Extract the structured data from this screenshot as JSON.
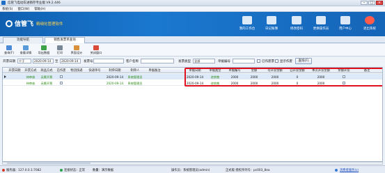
{
  "window": {
    "title": "信管飞电动车进销存专业版 V9.2.446"
  },
  "menu": [
    "系统(S)",
    "窗口(W)",
    "帮助(H)"
  ],
  "brand": {
    "name": "信管飞",
    "subtitle": "精细化管理软件"
  },
  "top_buttons": [
    {
      "label": "我的工作台",
      "icon": "desktop-icon"
    },
    {
      "label": "日记账簿",
      "icon": "ledger-icon"
    },
    {
      "label": "修改密码",
      "icon": "key-icon"
    },
    {
      "label": "更换操作员",
      "icon": "user-switch-icon"
    },
    {
      "label": "用户中心",
      "icon": "user-center-icon"
    },
    {
      "label": "退出系统",
      "icon": "power-icon"
    }
  ],
  "tabs": [
    "功能导航",
    "销售发票单查询"
  ],
  "toolbar": [
    "查询(F)",
    "查看详情",
    "导出数据",
    "打印",
    "界面设计",
    "关闭窗口"
  ],
  "filter": {
    "date_label": "开票日期",
    "date_op": "介于",
    "date_from": "2020-09-14",
    "date_sep": "至",
    "date_to": "2020-09-14",
    "invoice_no_label": "发票号",
    "invoice_no": "",
    "customer_label": "客户名称",
    "customer": "",
    "type_label": "发票类型",
    "type": "全部",
    "doc_no_label": "单据编号",
    "doc_no": "",
    "cb_voided": "已作废票",
    "cb_show_detail": "显示作废",
    "query_btn": "查询(F)"
  },
  "grid": {
    "columns": [
      "开票日期",
      "开票方式",
      "商品方式",
      "已作废",
      "物流快递",
      "快递单号",
      "制单日期",
      "制单人",
      "单据备注",
      "单据日期",
      "单据类型",
      "单据编号",
      "金额",
      "可开票金额",
      "已开票金额",
      "本次开票金额",
      "余额开票",
      "备注"
    ],
    "rows": [
      [
        "",
        "待审核",
        "无需开票",
        "",
        "",
        "",
        "2020-09-14",
        "系统管理员",
        "",
        "2020-09-14",
        "进销售",
        "2000",
        "2000",
        "2000",
        "0",
        "2000",
        "",
        ""
      ],
      [
        "",
        "待审核",
        "无需开票",
        "",
        "",
        "",
        "2020-09-14",
        "系统管理员",
        "",
        "2020-09-14",
        "进销售",
        "2000",
        "2000",
        "2000",
        "0",
        "2000",
        "",
        ""
      ]
    ]
  },
  "status": {
    "server": "服务器：127.0.0.1:7082",
    "conn": "连接状态：正常",
    "sel_count": "数量：演示数据",
    "operator": "操作员：系统管理员(admin)",
    "company": "正式版 授权序列号：pc003_8ea",
    "link": "消费者服务(s)"
  },
  "colors": {
    "banner": "#1565b8",
    "highlight": "#e0101e",
    "approved": "#2d8a12"
  }
}
